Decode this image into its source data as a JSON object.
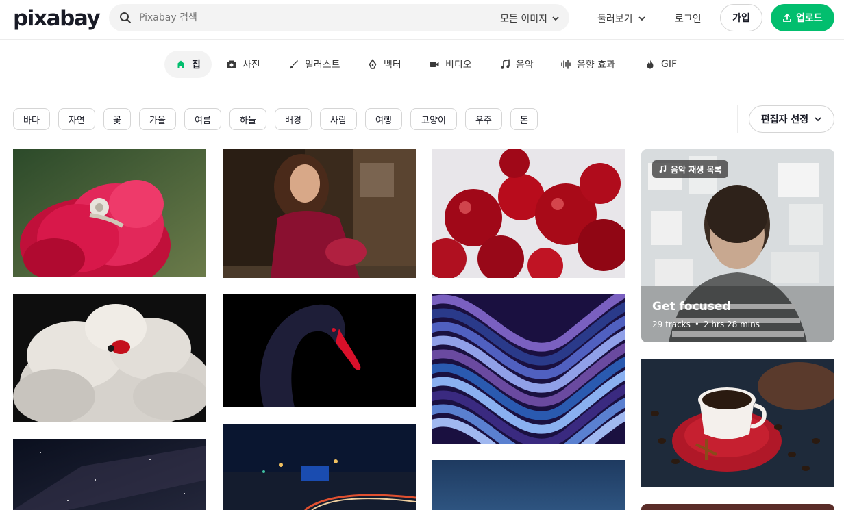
{
  "header": {
    "logo": "pixabay",
    "search_placeholder": "Pixabay 검색",
    "search_type": "모든 이미지",
    "explore": "둘러보기",
    "login": "로그인",
    "join": "가입",
    "upload": "업로드",
    "accent_color": "#02be6e"
  },
  "tabs": [
    {
      "label": "집",
      "icon": "home-icon",
      "active": true
    },
    {
      "label": "사진",
      "icon": "camera-icon"
    },
    {
      "label": "일러스트",
      "icon": "brush-icon"
    },
    {
      "label": "벡터",
      "icon": "pen-nib-icon"
    },
    {
      "label": "비디오",
      "icon": "video-icon"
    },
    {
      "label": "음악",
      "icon": "music-note-icon"
    },
    {
      "label": "음향 효과",
      "icon": "waveform-icon"
    },
    {
      "label": "GIF",
      "icon": "flame-icon"
    }
  ],
  "tags": [
    "바다",
    "자연",
    "꽃",
    "가을",
    "여름",
    "하늘",
    "배경",
    "사람",
    "여행",
    "고양이",
    "우주",
    "돈"
  ],
  "editors_choice": "편집자 선정",
  "playlist": {
    "badge": "음악 재생 목록",
    "title": "Get focused",
    "tracks": "29 tracks",
    "duration": "2 hrs 28 mins"
  }
}
